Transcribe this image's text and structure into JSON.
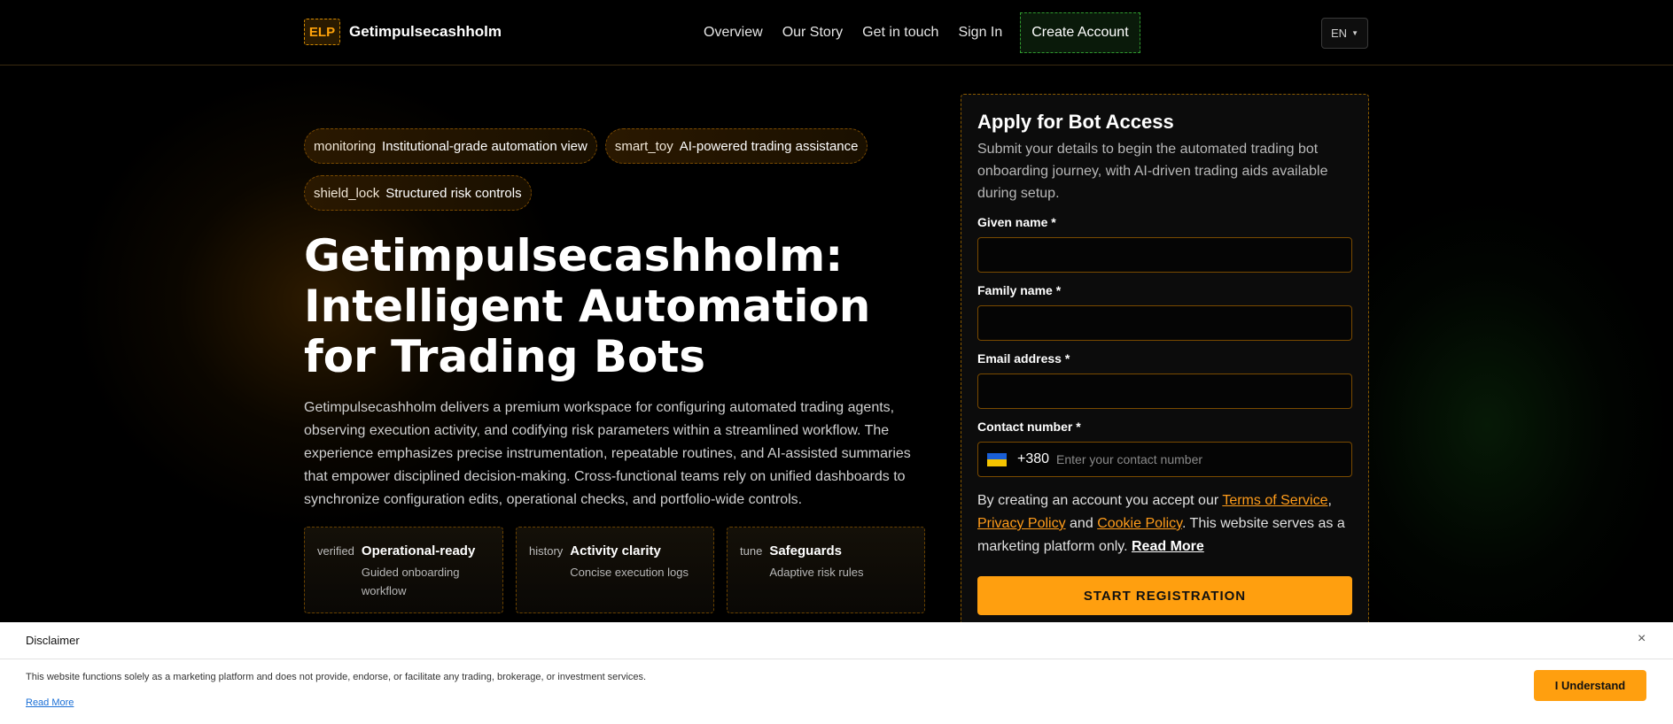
{
  "brand": {
    "logo_mark": "ELP",
    "name": "Getimpulsecashholm"
  },
  "nav": {
    "items": [
      "Overview",
      "Our Story",
      "Get in touch",
      "Sign In"
    ],
    "create_account": "Create Account",
    "lang": "EN"
  },
  "chips": [
    {
      "icon": "monitoring",
      "label": "Institutional-grade automation view"
    },
    {
      "icon": "smart_toy",
      "label": "AI-powered trading assistance"
    },
    {
      "icon": "shield_lock",
      "label": "Structured risk controls"
    }
  ],
  "hero": {
    "title": "Getimpulsecashholm: Intelligent Automation for Trading Bots",
    "description": "Getimpulsecashholm delivers a premium workspace for configuring automated trading agents, observing execution activity, and codifying risk parameters within a streamlined workflow. The experience emphasizes precise instrumentation, repeatable routines, and AI-assisted summaries that empower disciplined decision-making. Cross-functional teams rely on unified dashboards to synchronize configuration edits, operational checks, and portfolio-wide controls."
  },
  "features": [
    {
      "icon": "verified",
      "title": "Operational-ready",
      "desc": "Guided onboarding workflow"
    },
    {
      "icon": "history",
      "title": "Activity clarity",
      "desc": "Concise execution logs"
    },
    {
      "icon": "tune",
      "title": "Safeguards",
      "desc": "Adaptive risk rules"
    }
  ],
  "form": {
    "title": "Apply for Bot Access",
    "subtitle": "Submit your details to begin the automated trading bot onboarding journey, with AI-driven trading aids available during setup.",
    "given_name_label": "Given name *",
    "given_name_value": "",
    "family_name_label": "Family name *",
    "family_name_value": "",
    "email_label": "Email address *",
    "email_value": "",
    "phone_label": "Contact number *",
    "phone_code": "+380",
    "phone_placeholder": "Enter your contact number",
    "terms_prefix": "By creating an account you accept our",
    "terms_link": "Terms of Service",
    "privacy_link": "Privacy Policy",
    "and": "and",
    "cookie_link": "Cookie Policy",
    "terms_suffix": ". This website serves as a marketing platform only.",
    "read_more": "Read More",
    "submit": "START REGISTRATION"
  },
  "disclaimer": {
    "title": "Disclaimer",
    "close": "×",
    "text": "This website functions solely as a marketing platform and does not provide, endorse, or facilitate any trading, brokerage, or investment services.",
    "read_more": "Read More",
    "button": "I Understand"
  }
}
